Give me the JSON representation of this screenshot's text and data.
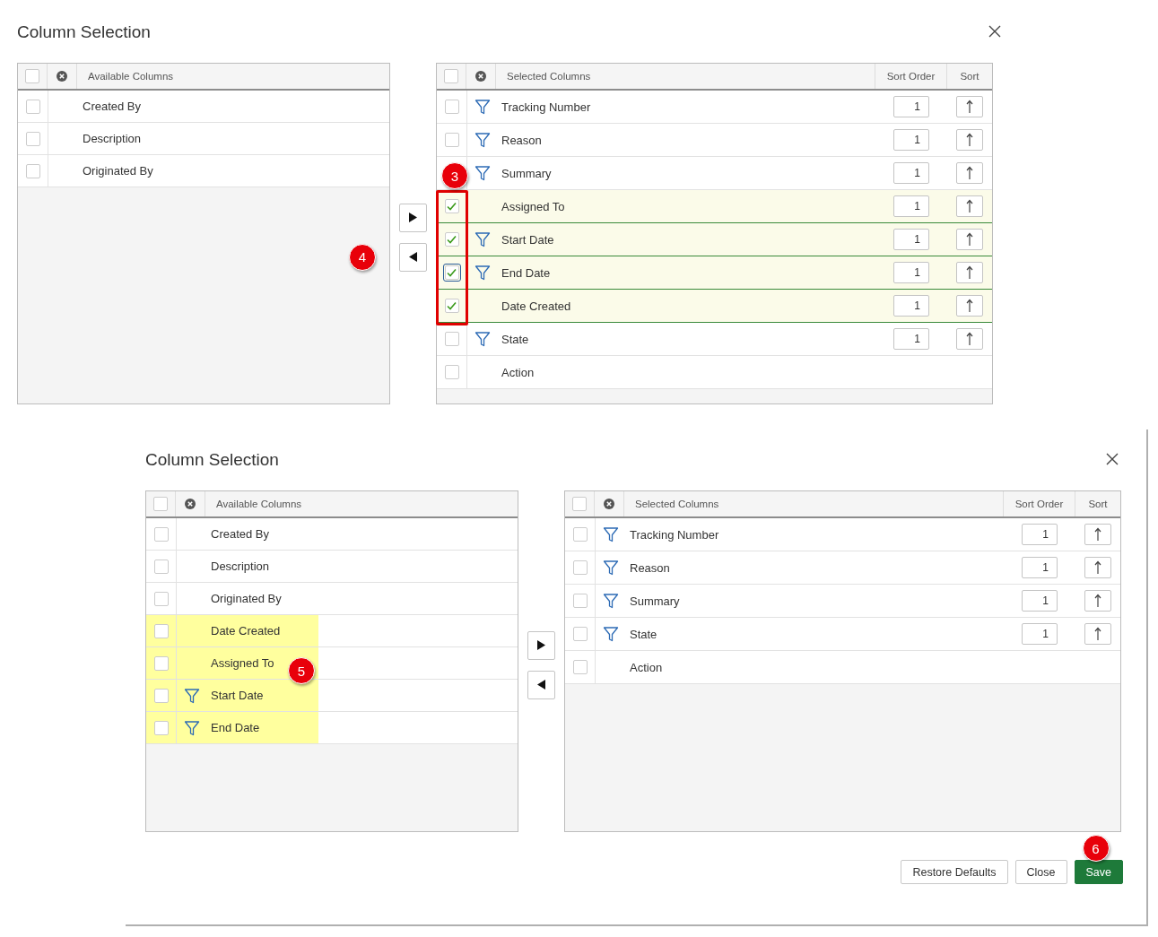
{
  "dialogs": [
    {
      "title": "Column Selection",
      "move_callout": "4",
      "available": {
        "header": "Available Columns",
        "all_checked": false,
        "rows": [
          {
            "label": "Created By",
            "filter": false,
            "checked": false,
            "highlighted": false
          },
          {
            "label": "Description",
            "filter": false,
            "checked": false,
            "highlighted": false
          },
          {
            "label": "Originated By",
            "filter": false,
            "checked": false,
            "highlighted": false
          }
        ]
      },
      "selected": {
        "header": "Selected Columns",
        "sort_order_header": "Sort Order",
        "sort_header": "Sort",
        "callout": "3",
        "outline_checked": true,
        "all_checked": false,
        "rows": [
          {
            "label": "Tracking Number",
            "filter": true,
            "checked": false,
            "selected": false,
            "focused": false,
            "sort_order": "1"
          },
          {
            "label": "Reason",
            "filter": true,
            "checked": false,
            "selected": false,
            "focused": false,
            "sort_order": "1"
          },
          {
            "label": "Summary",
            "filter": true,
            "selected": false,
            "focused": false,
            "sort_order": "1"
          },
          {
            "label": "Assigned To",
            "filter": false,
            "checked": true,
            "selected": true,
            "focused": false,
            "sort_order": "1"
          },
          {
            "label": "Start Date",
            "filter": true,
            "checked": true,
            "selected": true,
            "focused": false,
            "sort_order": "1"
          },
          {
            "label": "End Date",
            "filter": true,
            "checked": true,
            "selected": true,
            "focused": true,
            "sort_order": "1"
          },
          {
            "label": "Date Created",
            "filter": false,
            "checked": true,
            "selected": true,
            "focused": false,
            "sort_order": "1"
          },
          {
            "label": "State",
            "filter": true,
            "checked": false,
            "selected": false,
            "focused": false,
            "sort_order": "1"
          },
          {
            "label": "Action",
            "filter": false,
            "checked": false,
            "selected": false,
            "focused": false
          }
        ]
      }
    },
    {
      "title": "Column Selection",
      "available": {
        "header": "Available Columns",
        "callout": "5",
        "all_checked": false,
        "rows": [
          {
            "label": "Created By",
            "filter": false,
            "checked": false,
            "highlighted": false
          },
          {
            "label": "Description",
            "filter": false,
            "checked": false,
            "highlighted": false
          },
          {
            "label": "Originated By",
            "filter": false,
            "checked": false,
            "highlighted": false
          },
          {
            "label": "Date Created",
            "filter": false,
            "checked": false,
            "highlighted": true
          },
          {
            "label": "Assigned To",
            "filter": false,
            "checked": false,
            "highlighted": true
          },
          {
            "label": "Start Date",
            "filter": true,
            "checked": false,
            "highlighted": true
          },
          {
            "label": "End Date",
            "filter": true,
            "checked": false,
            "highlighted": true
          }
        ]
      },
      "selected": {
        "header": "Selected Columns",
        "sort_order_header": "Sort Order",
        "sort_header": "Sort",
        "outline_checked": false,
        "all_checked": false,
        "rows": [
          {
            "label": "Tracking Number",
            "filter": true,
            "checked": false,
            "selected": false,
            "focused": false,
            "sort_order": "1"
          },
          {
            "label": "Reason",
            "filter": true,
            "checked": false,
            "selected": false,
            "focused": false,
            "sort_order": "1"
          },
          {
            "label": "Summary",
            "filter": true,
            "checked": false,
            "selected": false,
            "focused": false,
            "sort_order": "1"
          },
          {
            "label": "State",
            "filter": true,
            "checked": false,
            "selected": false,
            "focused": false,
            "sort_order": "1"
          },
          {
            "label": "Action",
            "filter": false,
            "checked": false,
            "selected": false,
            "focused": false
          }
        ]
      },
      "buttons": [
        {
          "label": "Restore Defaults",
          "kind": "secondary"
        },
        {
          "label": "Close",
          "kind": "secondary"
        },
        {
          "label": "Save",
          "kind": "primary",
          "callout": "6"
        }
      ]
    }
  ]
}
